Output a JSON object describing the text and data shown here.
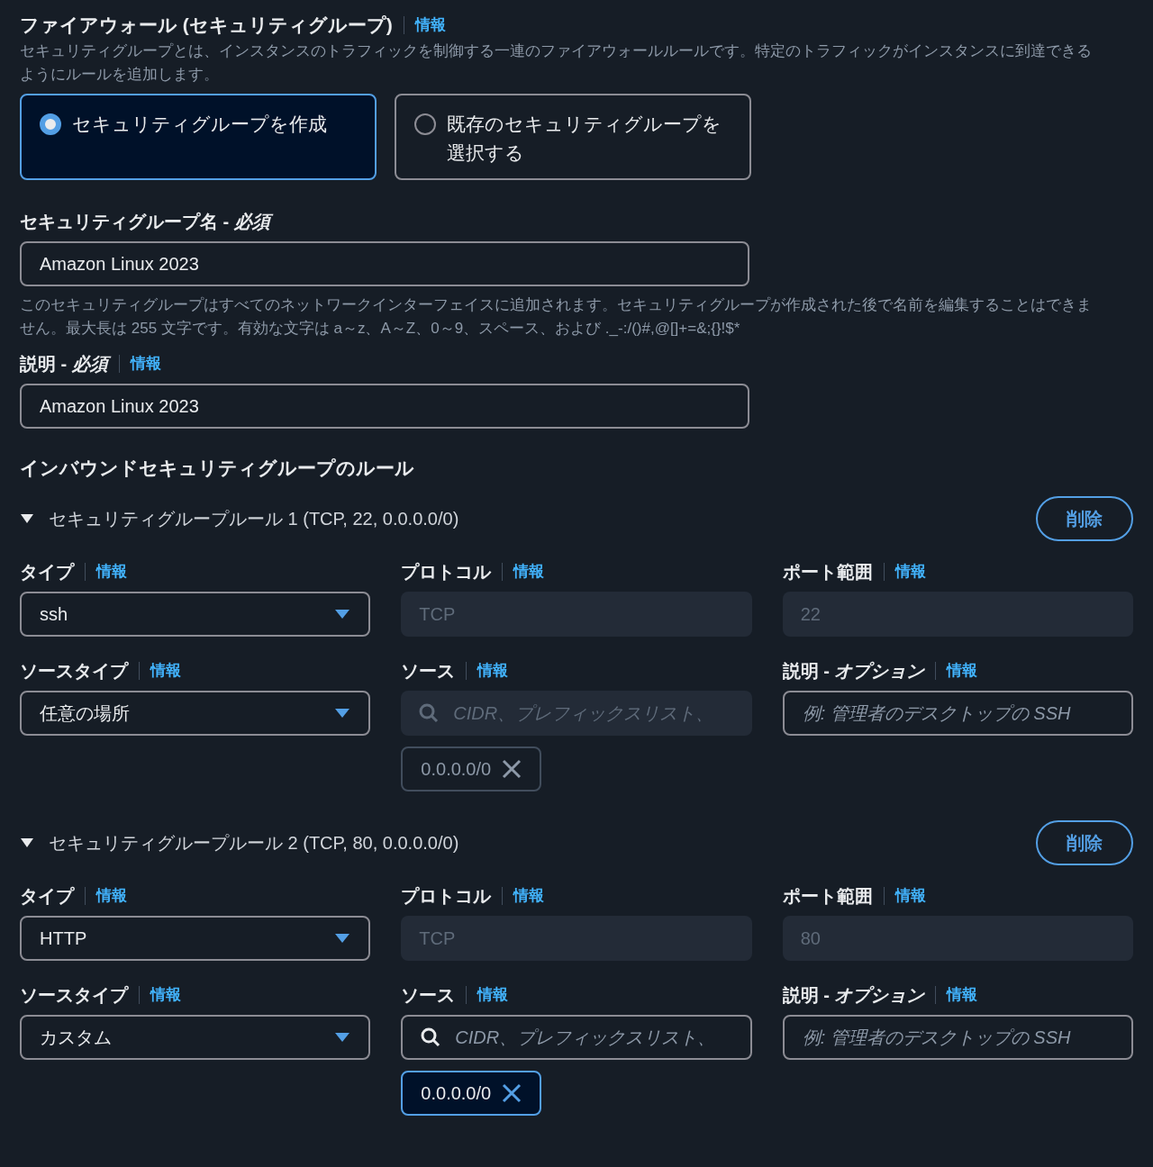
{
  "section": {
    "title": "ファイアウォール (セキュリティグループ)",
    "info": "情報",
    "description": "セキュリティグループとは、インスタンスのトラフィックを制御する一連のファイアウォールルールです。特定のトラフィックがインスタンスに到達できるようにルールを追加します。"
  },
  "options": [
    {
      "label": "セキュリティグループを作成",
      "selected": true
    },
    {
      "label": "既存のセキュリティグループを選択する",
      "selected": false
    }
  ],
  "name_field": {
    "label": "セキュリティグループ名 - *必須*",
    "value": "Amazon Linux 2023",
    "hint": "このセキュリティグループはすべてのネットワークインターフェイスに追加されます。セキュリティグループが作成された後で名前を編集することはできません。最大長は 255 文字です。有効な文字は a～z、A～Z、0～9、スペース、および ._-:/()#,@[]+=&;{}!$*"
  },
  "description_field": {
    "label": "説明 - *必須*",
    "info": "情報",
    "value": "Amazon Linux 2023"
  },
  "inbound": {
    "title": "インバウンドセキュリティグループのルール",
    "rules": [
      {
        "title": "セキュリティグループルール 1 (TCP, 22, 0.0.0.0/0)",
        "expanded": true,
        "delete": "削除",
        "type": {
          "label": "タイプ",
          "info": "情報",
          "value": "ssh"
        },
        "protocol": {
          "label": "プロトコル",
          "info": "情報",
          "value": "TCP",
          "disabled": true
        },
        "port": {
          "label": "ポート範囲",
          "info": "情報",
          "value": "22",
          "disabled": true
        },
        "source_type": {
          "label": "ソースタイプ",
          "info": "情報",
          "value": "任意の場所"
        },
        "source": {
          "label": "ソース",
          "info": "情報",
          "placeholder": "CIDR、プレフィックスリスト、",
          "disabled": true,
          "token": "0.0.0.0/0"
        },
        "rule_description": {
          "label": "説明 - *オプション*",
          "info": "情報",
          "placeholder": "例: 管理者のデスクトップの SSH"
        }
      },
      {
        "title": "セキュリティグループルール 2 (TCP, 80, 0.0.0.0/0)",
        "expanded": true,
        "delete": "削除",
        "type": {
          "label": "タイプ",
          "info": "情報",
          "value": "HTTP"
        },
        "protocol": {
          "label": "プロトコル",
          "info": "情報",
          "value": "TCP",
          "disabled": true
        },
        "port": {
          "label": "ポート範囲",
          "info": "情報",
          "value": "80",
          "disabled": true
        },
        "source_type": {
          "label": "ソースタイプ",
          "info": "情報",
          "value": "カスタム"
        },
        "source": {
          "label": "ソース",
          "info": "情報",
          "placeholder": "CIDR、プレフィックスリスト、",
          "disabled": false,
          "token": "0.0.0.0/0"
        },
        "rule_description": {
          "label": "説明 - *オプション*",
          "info": "情報",
          "placeholder": "例: 管理者のデスクトップの SSH"
        }
      }
    ]
  }
}
